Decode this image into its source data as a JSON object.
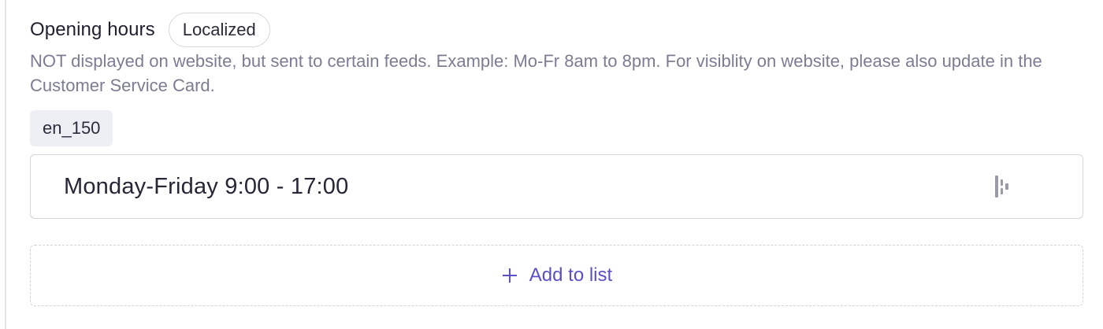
{
  "field": {
    "label": "Opening hours",
    "badge": "Localized",
    "help_text": "NOT displayed on website, but sent to certain feeds. Example: Mo-Fr 8am to 8pm. For visiblity on website, please also update in the Customer Service Card.",
    "locale": "en_150",
    "values": [
      "Monday-Friday 9:00 - 17:00"
    ],
    "add_label": "Add to list"
  },
  "icons": {
    "drag": "drag-handle-icon",
    "add": "plus-icon"
  },
  "colors": {
    "accent": "#5a4fc8",
    "muted_text": "#7c7c92",
    "border": "#d5d5dc",
    "tag_bg": "#eeeff5"
  }
}
